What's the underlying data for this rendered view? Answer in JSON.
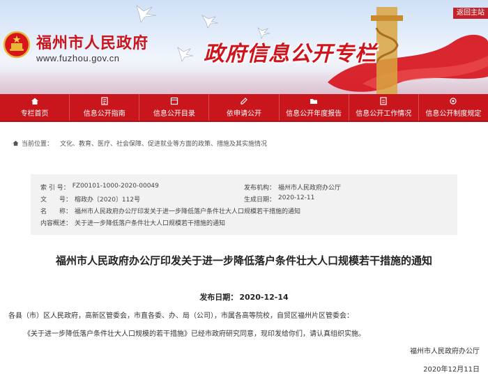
{
  "header": {
    "site_title": "福州市人民政府",
    "site_url": "www.fuzhou.gov.cn",
    "column_title": "政府信息公开专栏",
    "back_label": "返回主站",
    "emblem_icon": "national-emblem-icon",
    "colors": {
      "brand_red": "#c9161d",
      "title_red": "#d0141c"
    }
  },
  "nav": {
    "items": [
      {
        "label": "专栏首页",
        "icon": "home-icon"
      },
      {
        "label": "信息公开指南",
        "icon": "guide-icon"
      },
      {
        "label": "信息公开目录",
        "icon": "catalog-icon"
      },
      {
        "label": "依申请公开",
        "icon": "apply-icon"
      },
      {
        "label": "信息公开年度报告",
        "icon": "report-icon"
      },
      {
        "label": "信息公开工作情况",
        "icon": "work-icon"
      },
      {
        "label": "信息公开制度规定",
        "icon": "rules-icon"
      }
    ]
  },
  "breadcrumb": {
    "label": "当前位置：",
    "path": "文化、教育、医疗、社会保障、促进就业等方面的政策、措施及其实施情况"
  },
  "info": {
    "index_key": "索 引 号：",
    "index_val": "FZ00101-1000-2020-00049",
    "issuer_key": "发布机构：",
    "issuer_val": "福州市人民政府办公厅",
    "docno_key": "文　　号：",
    "docno_val": "榕政办〔2020〕112号",
    "created_key": "生成日期：",
    "created_val": "2020-12-11",
    "name_key": "名　　称：",
    "name_val": "福州市人民政府办公厅印发关于进一步降低落户条件壮大人口规模若干措施的通知",
    "summary_key": "内容概述：",
    "summary_val": "关于进一步降低落户条件壮大人口规模若干措施的通知"
  },
  "article": {
    "title": "福州市人民政府办公厅印发关于进一步降低落户条件壮大人口规模若干措施的通知",
    "pub_date_label": "发布日期：",
    "pub_date": "2020-12-14",
    "recipients": "各县（市）区人民政府，高新区管委会，市直各委、办、局（公司），市属各高等院校，自贸区福州片区管委会：",
    "body": "《关于进一步降低落户条件壮大人口规模的若干措施》已经市政府研究同意，现印发给你们，请认真组织实施。",
    "signature": "福州市人民政府办公厅",
    "sign_date": "2020年12月11日"
  }
}
